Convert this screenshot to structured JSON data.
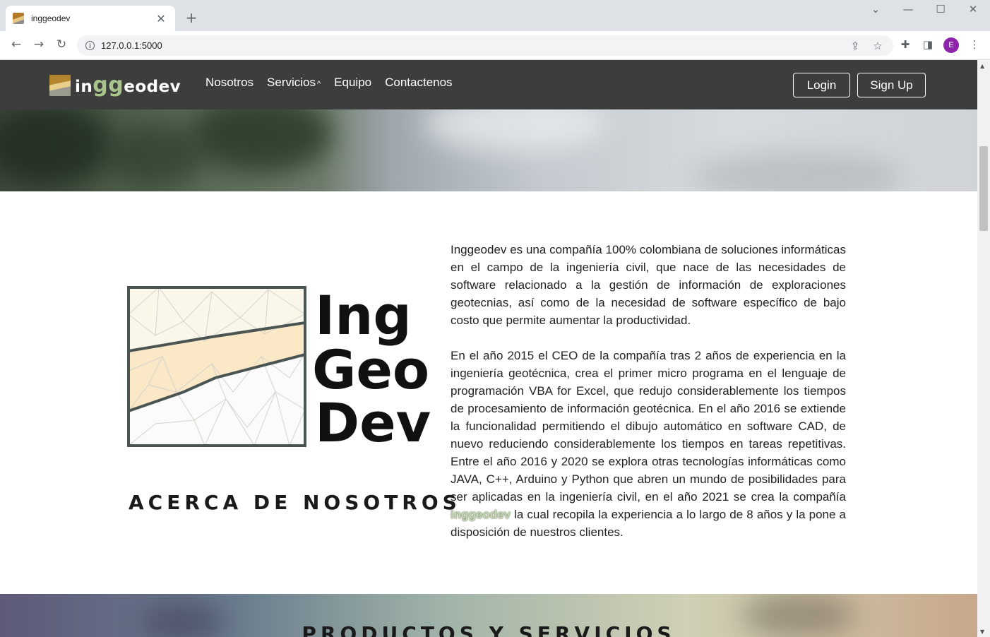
{
  "browser": {
    "tab_title": "inggeodev",
    "tab_close": "✕",
    "new_tab": "+",
    "url": "127.0.0.1:5000",
    "profile_initial": "E",
    "controls": {
      "dropdown": "⌄",
      "minimize": "—",
      "maximize": "☐",
      "close": "✕"
    }
  },
  "site": {
    "brand": {
      "prefix": "in",
      "gg": "gg",
      "suffix": "eodev"
    },
    "nav": {
      "nosotros": "Nosotros",
      "servicios": "Servicios",
      "servicios_caret": "^",
      "equipo": "Equipo",
      "contactenos": "Contactenos"
    },
    "auth": {
      "login": "Login",
      "signup": "Sign Up"
    },
    "logo_words": {
      "line1": "Ing",
      "line2": "Geo",
      "line3": "Dev"
    },
    "about": {
      "heading": "ACERCA DE NOSOTROS",
      "paragraph1": "Inggeodev es una compañía 100% colombiana de soluciones informáticas en el campo de la ingeniería civil, que nace de las necesidades de software relacionado a la gestión de información de exploraciones geotecnias, así como de la necesidad de software específico de bajo costo que permite aumentar la productividad.",
      "paragraph2_before": "En el año 2015 el CEO de la compañía tras 2 años de experiencia en la ingeniería geotécnica, crea el primer micro programa en el lenguaje de programación VBA for Excel, que redujo considerablemente los tiempos de procesamiento de información geotécnica. En el año 2016 se extiende la funcionalidad permitiendo el dibujo automático en software CAD, de nuevo reduciendo considerablemente los tiempos en tareas repetitivas. Entre el año 2016 y 2020 se explora otras tecnologías informáticas como JAVA, C++, Arduino y Python que abren un mundo de posibilidades para ser aplicadas en la ingeniería civil, en el año 2021 se crea la compañía ",
      "paragraph2_brand": "inggeodev",
      "paragraph2_after": " la cual recopila la experiencia a lo largo de 8 años y la pone a disposición de nuestros clientes."
    },
    "products": {
      "heading": "PRODUCTOS Y SERVICIOS"
    }
  },
  "colors": {
    "navbar_bg": "#3d3d3d",
    "brand_gg": "#a7c48a",
    "logo_frame": "#4a5553",
    "logo_band": "#fbe8c6",
    "logo_top": "#fbf6ea"
  }
}
